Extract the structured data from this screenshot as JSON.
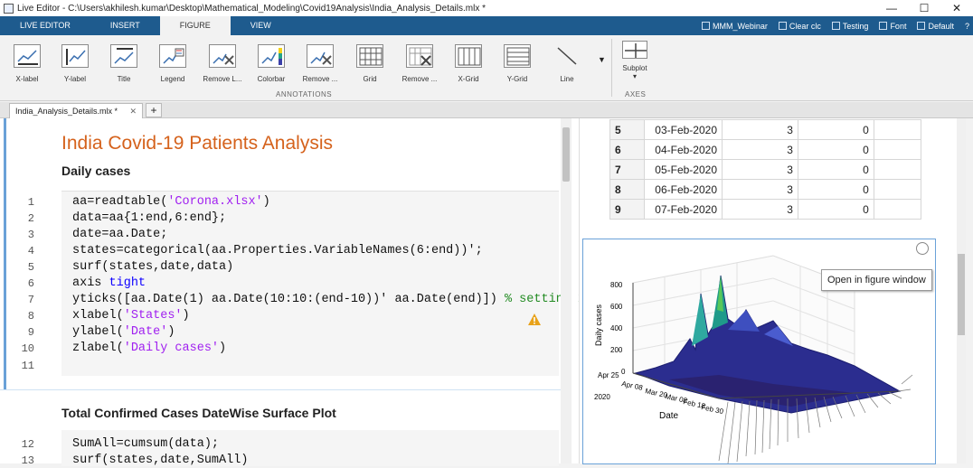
{
  "window": {
    "title": "Live Editor - C:\\Users\\akhilesh.kumar\\Desktop\\Mathematical_Modeling\\Covid19Analysis\\India_Analysis_Details.mlx *",
    "min": "—",
    "max": "☐",
    "close": "✕"
  },
  "tabs": [
    "LIVE EDITOR",
    "INSERT",
    "FIGURE",
    "VIEW"
  ],
  "quick_access": [
    "MMM_Webinar",
    "Clear clc",
    "Testing",
    "Font",
    "Default"
  ],
  "ribbon": {
    "buttons": [
      "X-label",
      "Y-label",
      "Title",
      "Legend",
      "Remove L...",
      "Colorbar",
      "Remove ...",
      "Grid",
      "Remove ...",
      "X-Grid",
      "Y-Grid",
      "Line"
    ],
    "subplot": "Subplot",
    "group_annotations": "ANNOTATIONS",
    "group_axes": "AXES"
  },
  "doc_tab": {
    "name": "India_Analysis_Details.mlx *",
    "close": "✕",
    "add": "+"
  },
  "editor": {
    "title": "India Covid-19 Patients Analysis",
    "section1": "Daily cases",
    "line_numbers": [
      "1",
      "2",
      "3",
      "4",
      "5",
      "6",
      "7",
      "8",
      "9",
      "10",
      "11"
    ],
    "section2": "Total Confirmed Cases DateWise Surface Plot",
    "line_numbers2": [
      "12",
      "13"
    ]
  },
  "output": {
    "table_rows": [
      {
        "idx": "5",
        "date": "03-Feb-2020",
        "a": "3",
        "b": "0"
      },
      {
        "idx": "6",
        "date": "04-Feb-2020",
        "a": "3",
        "b": "0"
      },
      {
        "idx": "7",
        "date": "05-Feb-2020",
        "a": "3",
        "b": "0"
      },
      {
        "idx": "8",
        "date": "06-Feb-2020",
        "a": "3",
        "b": "0"
      },
      {
        "idx": "9",
        "date": "07-Feb-2020",
        "a": "3",
        "b": "0"
      }
    ],
    "tooltip": "Open in figure window",
    "plot": {
      "zlabel": "Daily cases",
      "ylabel": "Date",
      "z_ticks": [
        "800",
        "600",
        "400",
        "200",
        "0"
      ],
      "date_ticks": [
        "Apr 25",
        "Apr 08",
        "Mar 20",
        "Mar 08",
        "Feb 18",
        "Feb 30"
      ],
      "year": "2020"
    }
  }
}
